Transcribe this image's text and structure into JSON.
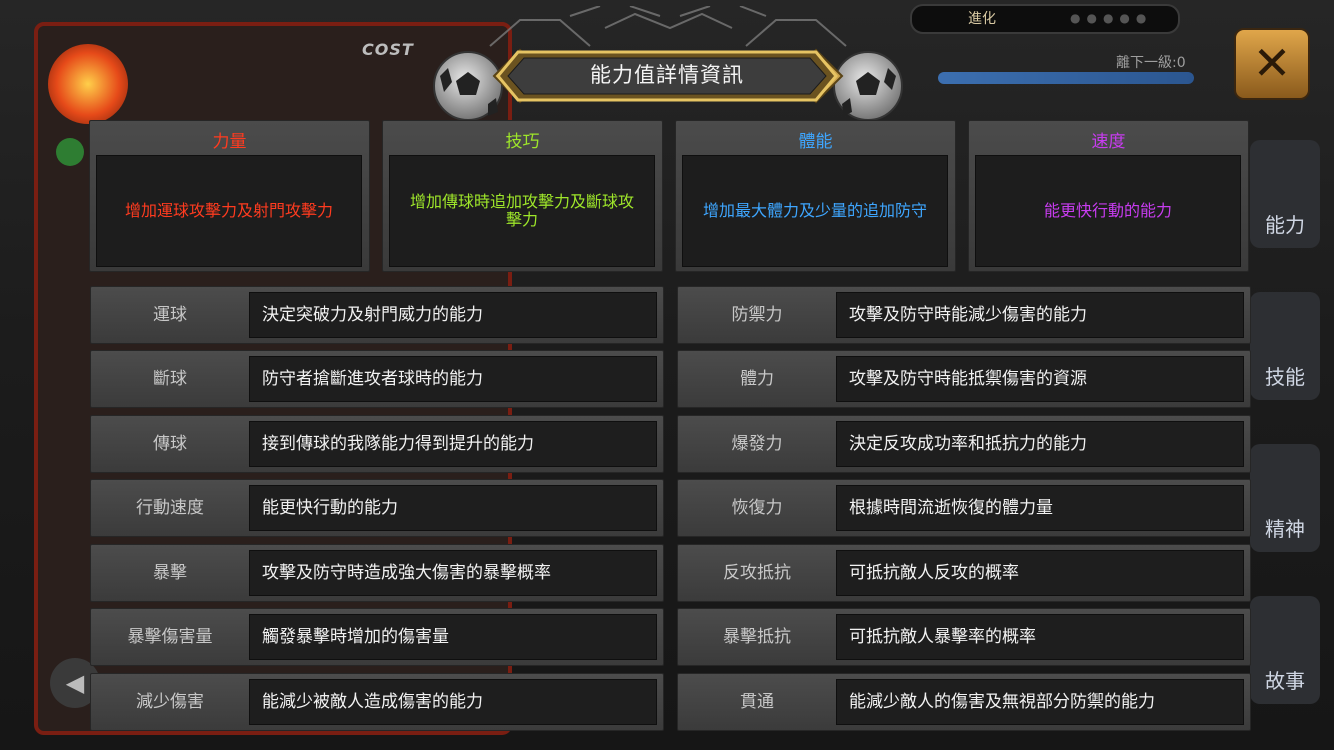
{
  "modal": {
    "title": "能力值詳情資訊"
  },
  "attributes": [
    {
      "name": "力量",
      "desc": "增加運球攻擊力及射門攻擊力",
      "color": "#ff3b1f"
    },
    {
      "name": "技巧",
      "desc": "增加傳球時追加攻擊力及斷球攻擊力",
      "color": "#9ee62a"
    },
    {
      "name": "體能",
      "desc": "增加最大體力及少量的追加防守",
      "color": "#3ea6ff"
    },
    {
      "name": "速度",
      "desc": "能更快行動的能力",
      "color": "#c83cf0"
    }
  ],
  "stats_left": [
    {
      "name": "運球",
      "desc": "決定突破力及射門威力的能力"
    },
    {
      "name": "斷球",
      "desc": "防守者搶斷進攻者球時的能力"
    },
    {
      "name": "傳球",
      "desc": "接到傳球的我隊能力得到提升的能力"
    },
    {
      "name": "行動速度",
      "desc": "能更快行動的能力"
    },
    {
      "name": "暴擊",
      "desc": "攻擊及防守時造成強大傷害的暴擊概率"
    },
    {
      "name": "暴擊傷害量",
      "desc": "觸發暴擊時增加的傷害量"
    },
    {
      "name": "減少傷害",
      "desc": "能減少被敵人造成傷害的能力"
    }
  ],
  "stats_right": [
    {
      "name": "防禦力",
      "desc": "攻擊及防守時能減少傷害的能力"
    },
    {
      "name": "體力",
      "desc": "攻擊及防守時能抵禦傷害的資源"
    },
    {
      "name": "爆發力",
      "desc": "決定反攻成功率和抵抗力的能力"
    },
    {
      "name": "恢復力",
      "desc": "根據時間流逝恢復的體力量"
    },
    {
      "name": "反攻抵抗",
      "desc": "可抵抗敵人反攻的概率"
    },
    {
      "name": "暴擊抵抗",
      "desc": "可抵抗敵人暴擊率的概率"
    },
    {
      "name": "貫通",
      "desc": "能減少敵人的傷害及無視部分防禦的能力"
    }
  ],
  "background": {
    "cost_label": "COST",
    "evolve_label": "進化",
    "next_level_label": "離下一級:0",
    "close_icon": "close-icon",
    "side_buttons": [
      "能力",
      "技能",
      "精神",
      "故事"
    ]
  }
}
